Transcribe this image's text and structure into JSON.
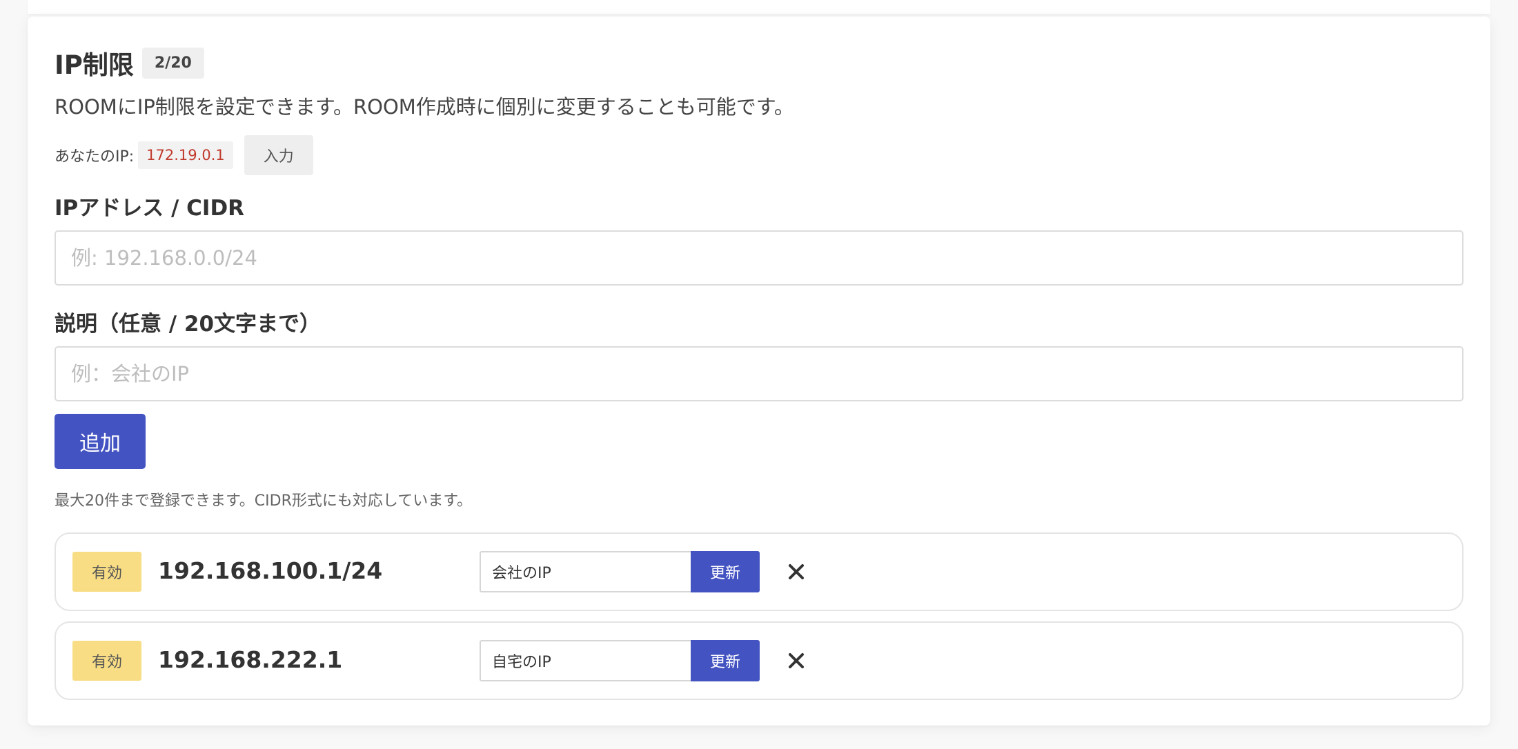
{
  "section": {
    "title": "IP制限",
    "count": "2/20",
    "description": "ROOMにIP制限を設定できます。ROOM作成時に個別に変更することも可能です。",
    "my_ip_label": "あなたのIP:",
    "my_ip_value": "172.19.0.1",
    "fill_ip_label": "入力"
  },
  "form": {
    "ip_label": "IPアドレス / CIDR",
    "ip_placeholder": "例: 192.168.0.0/24",
    "ip_value": "",
    "desc_label": "説明（任意 / 20文字まで）",
    "desc_placeholder": "例：会社のIP",
    "desc_value": "",
    "add_label": "追加",
    "note": "最大20件まで登録できます。CIDR形式にも対応しています。"
  },
  "entries": [
    {
      "status": "有効",
      "ip": "192.168.100.1/24",
      "description": "会社のIP",
      "update_label": "更新",
      "delete_icon": "close-icon"
    },
    {
      "status": "有効",
      "ip": "192.168.222.1",
      "description": "自宅のIP",
      "update_label": "更新",
      "delete_icon": "close-icon"
    }
  ],
  "colors": {
    "primary": "#4453c2",
    "status_active": "#f8dd85",
    "ip_highlight": "#c0392b"
  }
}
